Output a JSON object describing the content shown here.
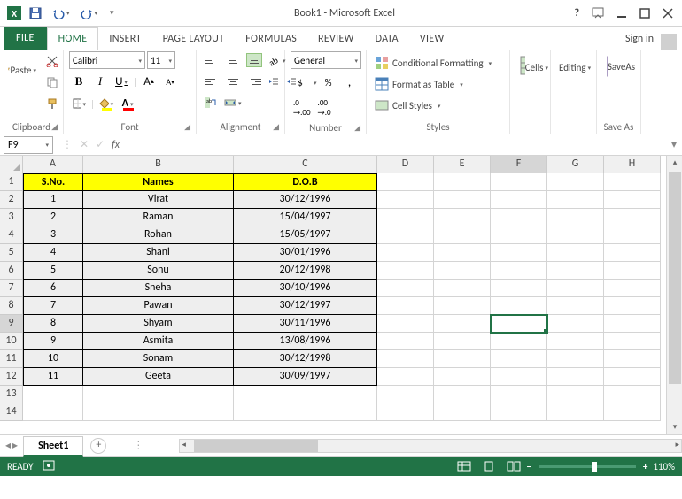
{
  "title": "Book1 - Microsoft Excel",
  "qat": {
    "save": "save-icon",
    "undo": "undo-icon",
    "redo": "redo-icon"
  },
  "window": {
    "help": "?",
    "signin": "Sign in"
  },
  "tabs": {
    "file": "FILE",
    "home": "HOME",
    "insert": "INSERT",
    "page_layout": "PAGE LAYOUT",
    "formulas": "FORMULAS",
    "review": "REVIEW",
    "data": "DATA",
    "view": "VIEW"
  },
  "ribbon": {
    "clipboard": {
      "label": "Clipboard",
      "paste": "Paste"
    },
    "font": {
      "label": "Font",
      "name": "Calibri",
      "size": "11",
      "bold": "B",
      "italic": "I",
      "underline": "U",
      "grow": "A",
      "shrink": "A",
      "fill_color": "#ffff00",
      "font_color": "#ff0000"
    },
    "alignment": {
      "label": "Alignment",
      "wrap": "Wrap Text",
      "merge": "Merge & Center"
    },
    "number": {
      "label": "Number",
      "format": "General",
      "currency": "$",
      "percent": "%",
      "comma": ",",
      "inc_dec": ".0  .00",
      "dec_dec": ".00  .0"
    },
    "styles": {
      "label": "Styles",
      "cond_fmt": "Conditional Formatting",
      "as_table": "Format as Table",
      "cell_styles": "Cell Styles"
    },
    "cells": {
      "label": "Cells",
      "btn": "Cells"
    },
    "editing": {
      "label": "Editing",
      "btn": "Editing"
    },
    "save": {
      "label": "Save As",
      "btn1": "Save",
      "btn2": "As"
    }
  },
  "namebox": "F9",
  "formula": "",
  "columns": {
    "widths": {
      "A": 68,
      "B": 170,
      "C": 162,
      "D": 64,
      "E": 64,
      "F": 64,
      "G": 64,
      "H": 64
    },
    "labels": [
      "A",
      "B",
      "C",
      "D",
      "E",
      "F",
      "G",
      "H"
    ]
  },
  "row_labels": [
    "1",
    "2",
    "3",
    "4",
    "5",
    "6",
    "7",
    "8",
    "9",
    "10",
    "11",
    "12",
    "13",
    "14"
  ],
  "selection": {
    "col": "F",
    "row": 9
  },
  "headers": {
    "sno": "S.No.",
    "names": "Names",
    "dob": "D.O.B"
  },
  "data": [
    {
      "sno": "1",
      "name": "Virat",
      "dob": "30/12/1996"
    },
    {
      "sno": "2",
      "name": "Raman",
      "dob": "15/04/1997"
    },
    {
      "sno": "3",
      "name": "Rohan",
      "dob": "15/05/1997"
    },
    {
      "sno": "4",
      "name": "Shani",
      "dob": "30/01/1996"
    },
    {
      "sno": "5",
      "name": "Sonu",
      "dob": "20/12/1998"
    },
    {
      "sno": "6",
      "name": "Sneha",
      "dob": "30/10/1996"
    },
    {
      "sno": "7",
      "name": "Pawan",
      "dob": "30/12/1997"
    },
    {
      "sno": "8",
      "name": "Shyam",
      "dob": "30/11/1996"
    },
    {
      "sno": "9",
      "name": "Asmita",
      "dob": "13/08/1996"
    },
    {
      "sno": "10",
      "name": "Sonam",
      "dob": "30/12/1998"
    },
    {
      "sno": "11",
      "name": "Geeta",
      "dob": "30/09/1997"
    }
  ],
  "sheet_tab": "Sheet1",
  "status": {
    "ready": "READY",
    "zoom": "110%"
  }
}
